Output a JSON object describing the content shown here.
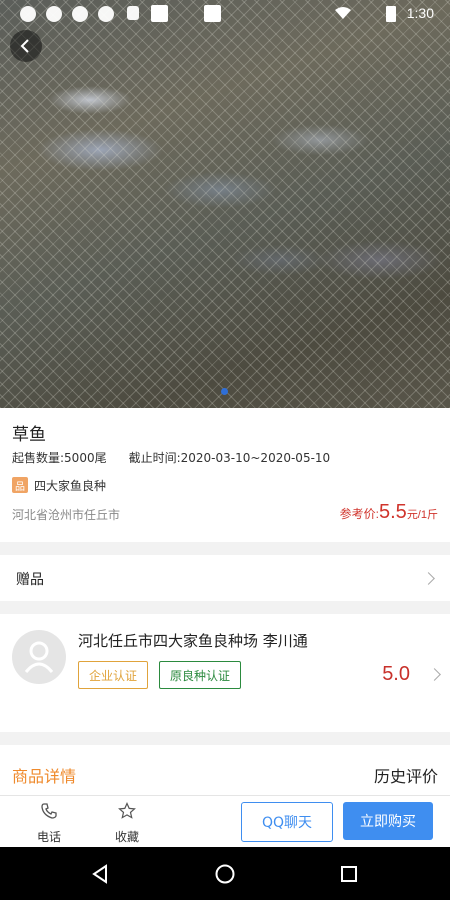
{
  "status_bar": {
    "time": "1:30"
  },
  "product": {
    "title": "草鱼",
    "min_qty_label": "起售数量:",
    "min_qty_value": "5000尾",
    "deadline_label": "截止时间:",
    "deadline_value": "2020-03-10~2020-05-10",
    "tag_icon_text": "品",
    "tag_text": "四大家鱼良种",
    "location": "河北省沧州市任丘市",
    "price_label": "参考价:",
    "price_value": "5.5",
    "price_unit": "元/1斤"
  },
  "gift": {
    "label": "赠品"
  },
  "seller": {
    "name": "河北任丘市四大家鱼良种场 李川通",
    "badge_enterprise": "企业认证",
    "badge_breed": "原良种认证",
    "rating": "5.0"
  },
  "detail_tabs": {
    "left": "商品详情",
    "right": "历史评价"
  },
  "bottom_bar": {
    "phone_label": "电话",
    "favorite_label": "收藏",
    "qq_label": "QQ聊天",
    "buy_label": "立即购买"
  },
  "colors": {
    "price_red": "#d0342c",
    "accent_blue": "#3f8ef0",
    "tab_orange": "#ef8a2c",
    "badge_gold": "#e0a33b",
    "badge_green": "#2b8a3e"
  },
  "icons": [
    "back-icon",
    "phone-icon",
    "star-icon",
    "chevron-right-icon",
    "back-triangle-icon",
    "home-circle-icon",
    "recents-square-icon"
  ]
}
